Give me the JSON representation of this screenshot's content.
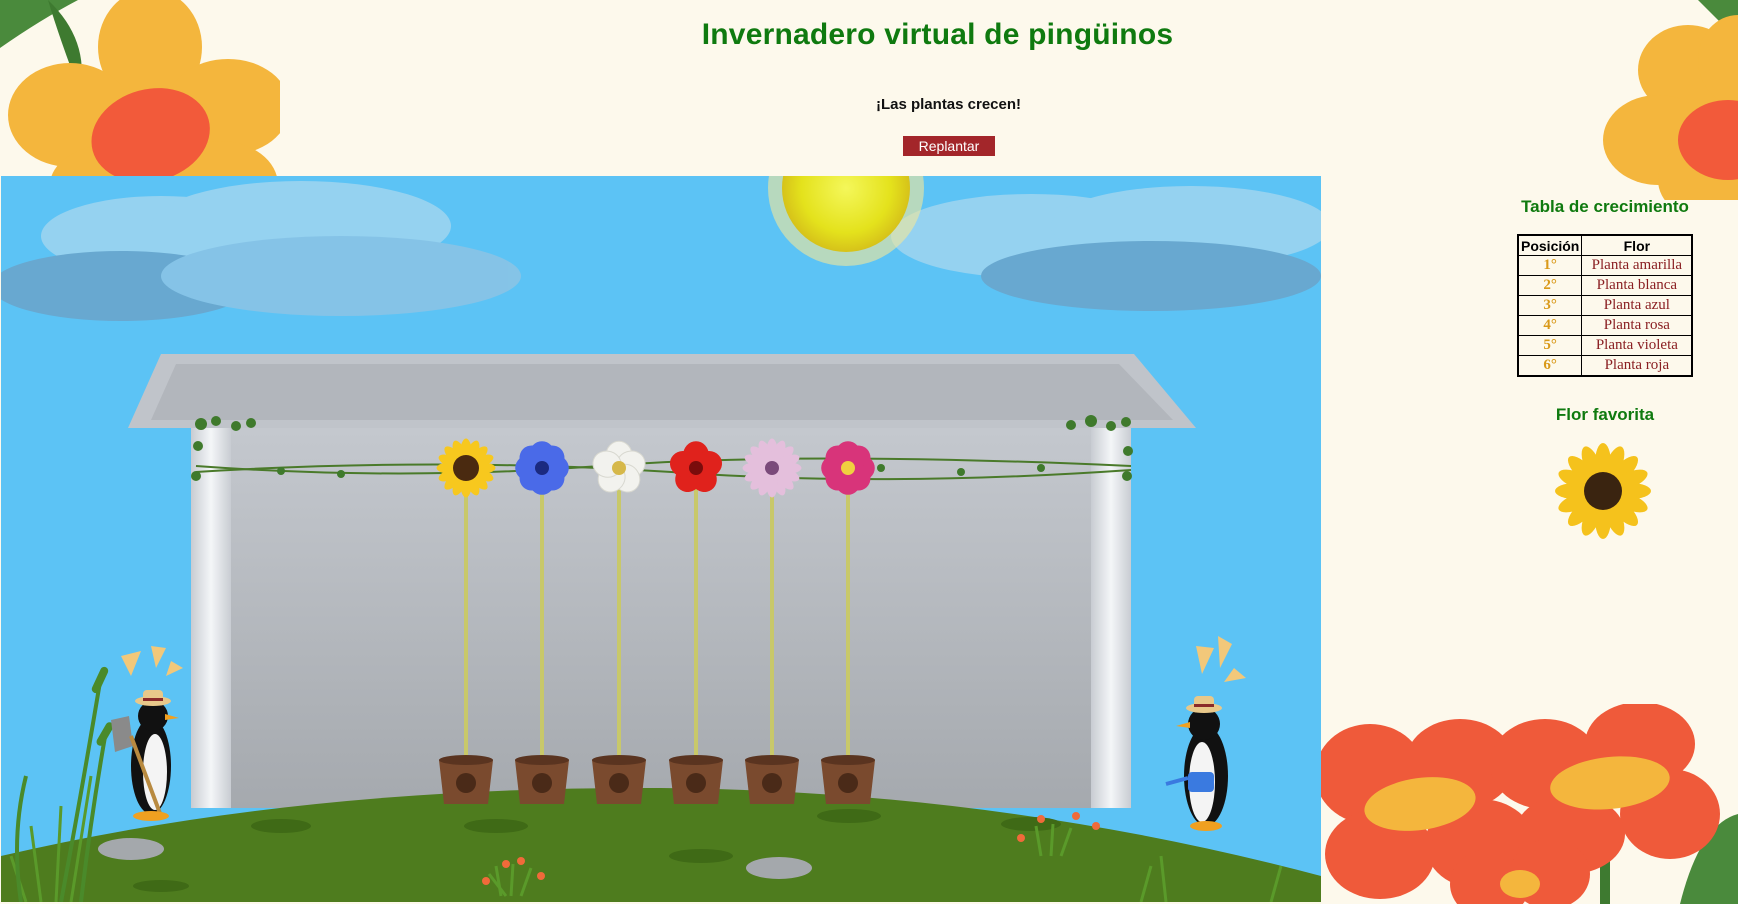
{
  "header": {
    "title": "Invernadero virtual de pingüinos",
    "status": "¡Las plantas crecen!",
    "replant_label": "Replantar"
  },
  "greenhouse": {
    "plants": [
      {
        "name": "sunflower",
        "color": "#f7c81e",
        "center": "#4a2a10"
      },
      {
        "name": "blue-anemone",
        "color": "#4a6ae8",
        "center": "#1b2a80"
      },
      {
        "name": "white-flower",
        "color": "#f2f2ee",
        "center": "#d6b84a"
      },
      {
        "name": "red-flower",
        "color": "#e0221c",
        "center": "#7a0c0c"
      },
      {
        "name": "pink-daisy",
        "color": "#e4bfdc",
        "center": "#7a4a7a"
      },
      {
        "name": "magenta-cosmos",
        "color": "#d8347a",
        "center": "#f0d040"
      }
    ],
    "penguins": [
      "gardener-with-shovel",
      "gardener-with-watering-can"
    ]
  },
  "sidebar": {
    "growth_title": "Tabla de crecimiento",
    "table": {
      "headers": [
        "Posición",
        "Flor"
      ],
      "rows": [
        {
          "pos": "1°",
          "flor": "Planta amarilla"
        },
        {
          "pos": "2°",
          "flor": "Planta blanca"
        },
        {
          "pos": "3°",
          "flor": "Planta azul"
        },
        {
          "pos": "4°",
          "flor": "Planta rosa"
        },
        {
          "pos": "5°",
          "flor": "Planta violeta"
        },
        {
          "pos": "6°",
          "flor": "Planta roja"
        }
      ]
    },
    "favorite_title": "Flor favorita",
    "favorite_icon": "sunflower-icon"
  },
  "colors": {
    "title_green": "#0f7a0f",
    "button_red": "#a3262a",
    "sky": "#5cc3f5",
    "grass": "#4e7c1e"
  }
}
